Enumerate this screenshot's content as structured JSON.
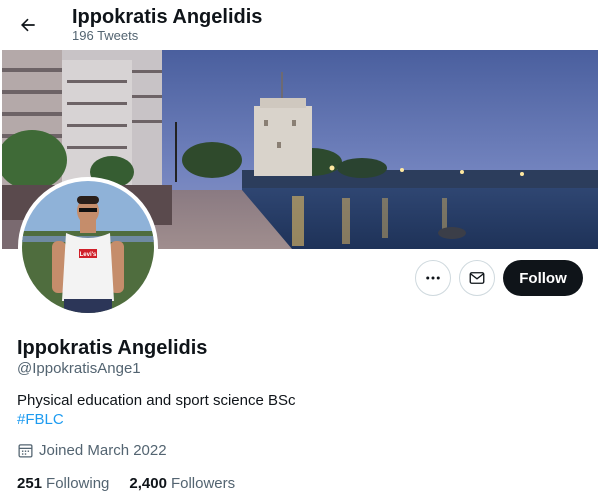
{
  "header": {
    "title": "Ippokratis Angelidis",
    "tweet_count": "196 Tweets"
  },
  "profile": {
    "name": "Ippokratis Angelidis",
    "handle": "@IppokratisAnge1",
    "bio": "Physical education and sport science BSc",
    "hashtag": "#FBLC",
    "joined": "Joined March 2022",
    "following_count": "251",
    "following_label": "Following",
    "followers_count": "2,400",
    "followers_label": "Followers"
  },
  "actions": {
    "more_icon": "more-icon",
    "message_icon": "envelope-icon",
    "follow_label": "Follow"
  },
  "avatar_shirt_text": "Levi's",
  "colors": {
    "link_blue": "#1d9bf0",
    "follow_bg": "#0f1419",
    "secondary_text": "#536471"
  }
}
